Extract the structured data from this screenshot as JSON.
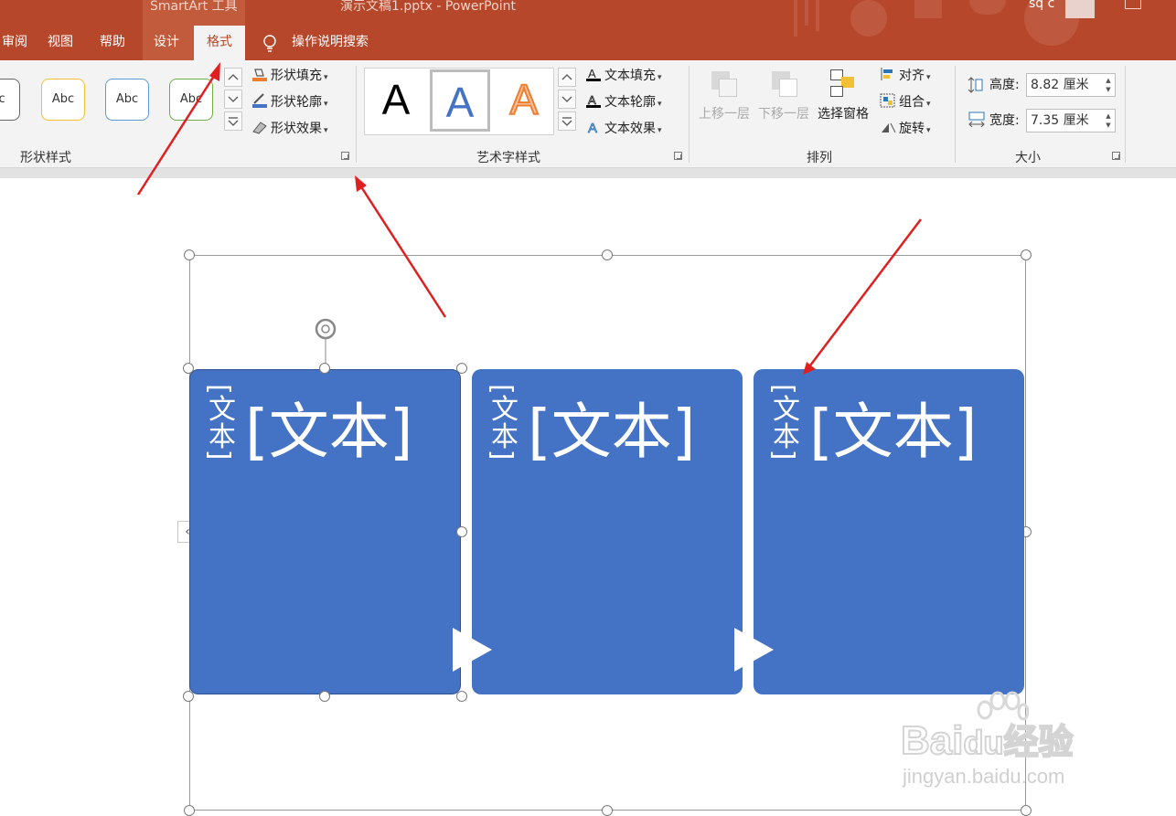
{
  "title_bar": {
    "context_tools": "SmartArt 工具",
    "document_title": "演示文稿1.pptx  -  PowerPoint",
    "user_name": "sq c"
  },
  "tabs": {
    "review": "审阅",
    "view": "视图",
    "help": "帮助",
    "design": "设计",
    "format": "格式",
    "tell_me": "操作说明搜索"
  },
  "shape_styles": {
    "group_label": "形状样式",
    "samples": [
      "bc",
      "Abc",
      "Abc",
      "Abc"
    ],
    "fill": "形状填充",
    "outline": "形状轮廓",
    "effects": "形状效果"
  },
  "wordart_styles": {
    "group_label": "艺术字样式",
    "samples": [
      "A",
      "A",
      "A"
    ],
    "fill": "文本填充",
    "outline": "文本轮廓",
    "effects": "文本效果"
  },
  "arrange": {
    "group_label": "排列",
    "bring_forward": "上移一层",
    "send_backward": "下移一层",
    "selection_pane": "选择窗格",
    "align": "对齐",
    "group": "组合",
    "rotate": "旋转"
  },
  "size": {
    "group_label": "大小",
    "height_label": "高度:",
    "height_value": "8.82 厘米",
    "width_label": "宽度:",
    "width_value": "7.35 厘米"
  },
  "slide": {
    "boxes": [
      {
        "vertical_text": "[文本]",
        "main_text": "[文本]"
      },
      {
        "vertical_text": "[文本]",
        "main_text": "[文本]"
      },
      {
        "vertical_text": "[文本]",
        "main_text": "[文本]"
      }
    ],
    "watermark_line1": "Bai",
    "watermark_line1b": "du",
    "watermark_line1c": "经验",
    "watermark_line2": "jingyan.baidu.com"
  },
  "colors": {
    "ribbon_accent": "#b7472a",
    "smartart_fill": "#4472c4",
    "annotation_arrow": "#e02020"
  }
}
